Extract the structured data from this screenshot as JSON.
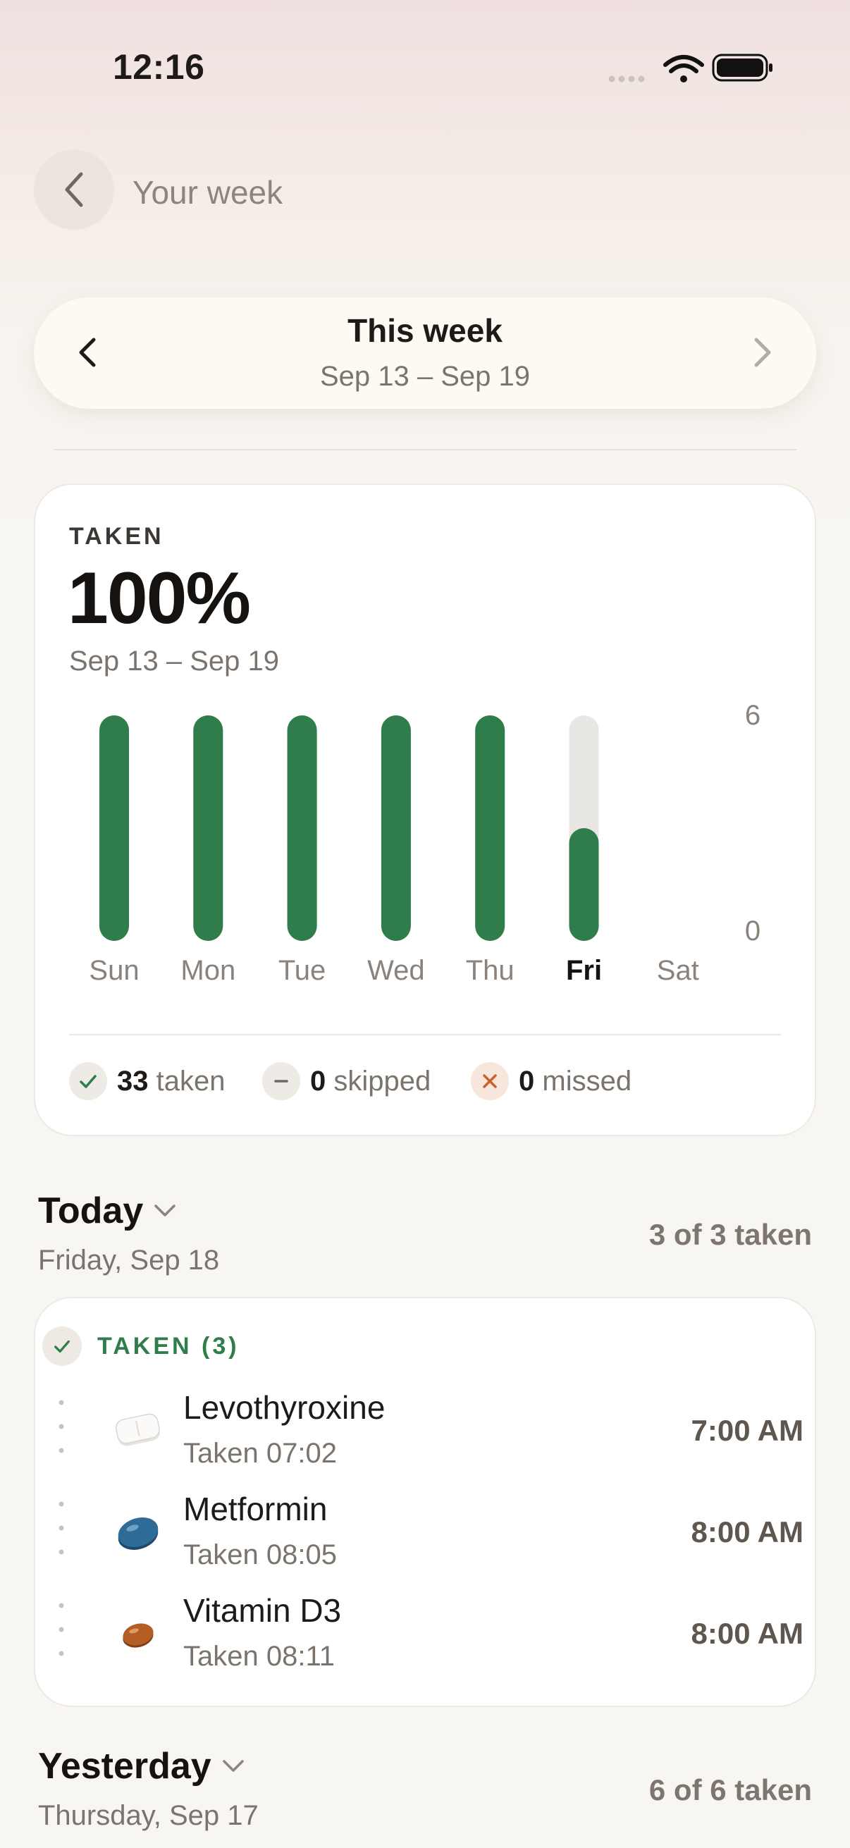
{
  "status_bar": {
    "time": "12:16",
    "icons": [
      "signal-icon",
      "wifi-icon",
      "battery-icon"
    ]
  },
  "header": {
    "back_icon": "chevron-left-icon",
    "title": "Your week"
  },
  "week_selector": {
    "title": "This week",
    "range": "Sep 13 – Sep 19",
    "prev_icon": "chevron-left-icon",
    "next_icon": "chevron-right-icon"
  },
  "adherence": {
    "label": "TAKEN",
    "percent": "100%",
    "range": "Sep 13 – Sep 19",
    "legend": [
      {
        "icon": "check-icon",
        "count": "33",
        "label": "taken"
      },
      {
        "icon": "minus-icon",
        "count": "0",
        "label": "skipped"
      },
      {
        "icon": "x-icon",
        "count": "0",
        "label": "missed"
      }
    ]
  },
  "chart_data": {
    "type": "bar",
    "categories": [
      "Sun",
      "Mon",
      "Tue",
      "Wed",
      "Thu",
      "Fri",
      "Sat"
    ],
    "series": [
      {
        "values": [
          6,
          6,
          6,
          6,
          6,
          3,
          null
        ]
      }
    ],
    "scheduled": [
      6,
      6,
      6,
      6,
      6,
      6,
      null
    ],
    "highlighted_category": "Fri",
    "ylim": [
      0,
      6
    ],
    "yticks": [
      "6",
      "0"
    ],
    "colors": {
      "bar": "#2f7d4a",
      "track": "#e8e7e4"
    }
  },
  "today": {
    "title": "Today",
    "date": "Friday, Sep 18",
    "count": "3 of 3 taken",
    "group_label": "TAKEN (3)",
    "meds": [
      {
        "name": "Levothyroxine",
        "status": "Taken 07:02",
        "time": "7:00 AM",
        "icon": "white-pill-icon"
      },
      {
        "name": "Metformin",
        "status": "Taken 08:05",
        "time": "8:00 AM",
        "icon": "blue-pill-icon"
      },
      {
        "name": "Vitamin D3",
        "status": "Taken 08:11",
        "time": "8:00 AM",
        "icon": "brown-pill-icon"
      }
    ]
  },
  "yesterday": {
    "title": "Yesterday",
    "date": "Thursday, Sep 17",
    "count": "6 of 6 taken"
  }
}
